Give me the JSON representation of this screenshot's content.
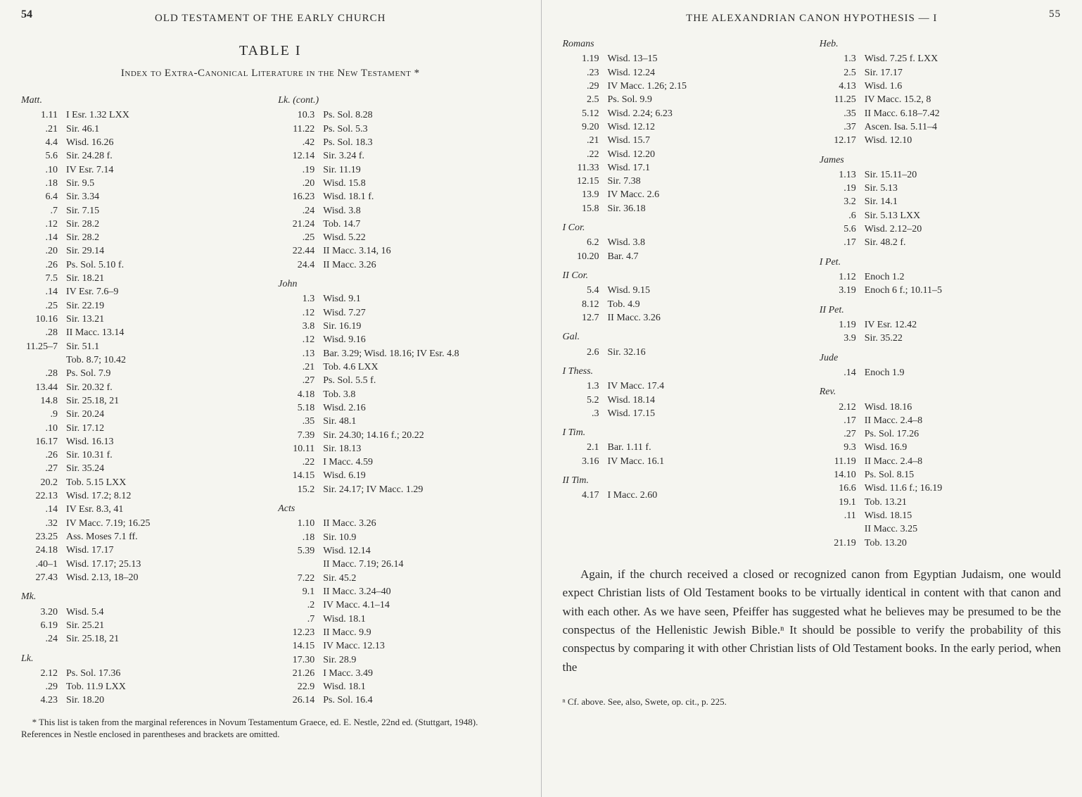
{
  "left": {
    "page_number": "54",
    "running_head": "OLD TESTAMENT OF THE EARLY CHURCH",
    "table_title": "TABLE I",
    "index_title": "Index to Extra-Canonical Literature in the New Testament *",
    "columns": [
      [
        {
          "head": "Matt."
        },
        {
          "v": "1.11",
          "r": "I Esr. 1.32 LXX"
        },
        {
          "v": ".21",
          "r": "Sir. 46.1"
        },
        {
          "v": "4.4",
          "r": "Wisd. 16.26"
        },
        {
          "v": "5.6",
          "r": "Sir. 24.28 f."
        },
        {
          "v": ".10",
          "r": "IV Esr. 7.14"
        },
        {
          "v": ".18",
          "r": "Sir. 9.5"
        },
        {
          "v": "6.4",
          "r": "Sir. 3.34"
        },
        {
          "v": ".7",
          "r": "Sir. 7.15"
        },
        {
          "v": ".12",
          "r": "Sir. 28.2"
        },
        {
          "v": ".14",
          "r": "Sir. 28.2"
        },
        {
          "v": ".20",
          "r": "Sir. 29.14"
        },
        {
          "v": ".26",
          "r": "Ps. Sol. 5.10 f."
        },
        {
          "v": "7.5",
          "r": "Sir. 18.21"
        },
        {
          "v": ".14",
          "r": "IV Esr. 7.6–9"
        },
        {
          "v": ".25",
          "r": "Sir. 22.19"
        },
        {
          "v": "10.16",
          "r": "Sir. 13.21"
        },
        {
          "v": ".28",
          "r": "II Macc. 13.14"
        },
        {
          "v": "11.25–7",
          "r": "Sir. 51.1"
        },
        {
          "v": "",
          "r": "Tob. 8.7; 10.42"
        },
        {
          "v": ".28",
          "r": "Ps. Sol. 7.9"
        },
        {
          "v": "13.44",
          "r": "Sir. 20.32 f."
        },
        {
          "v": "14.8",
          "r": "Sir. 25.18, 21"
        },
        {
          "v": ".9",
          "r": "Sir. 20.24"
        },
        {
          "v": ".10",
          "r": "Sir. 17.12"
        },
        {
          "v": "16.17",
          "r": "Wisd. 16.13"
        },
        {
          "v": ".26",
          "r": "Sir. 10.31 f."
        },
        {
          "v": ".27",
          "r": "Sir. 35.24"
        },
        {
          "v": "20.2",
          "r": "Tob. 5.15 LXX"
        },
        {
          "v": "22.13",
          "r": "Wisd. 17.2; 8.12"
        },
        {
          "v": ".14",
          "r": "IV Esr. 8.3, 41"
        },
        {
          "v": ".32",
          "r": "IV Macc. 7.19; 16.25"
        },
        {
          "v": "23.25",
          "r": "Ass. Moses 7.1 ff."
        },
        {
          "v": "24.18",
          "r": "Wisd. 17.17"
        },
        {
          "v": ".40–1",
          "r": "Wisd. 17.17; 25.13"
        },
        {
          "v": "27.43",
          "r": "Wisd. 2.13, 18–20"
        },
        {
          "head": "Mk."
        },
        {
          "v": "3.20",
          "r": "Wisd. 5.4"
        },
        {
          "v": "6.19",
          "r": "Sir. 25.21"
        },
        {
          "v": ".24",
          "r": "Sir. 25.18, 21"
        },
        {
          "head": "Lk."
        },
        {
          "v": "2.12",
          "r": "Ps. Sol. 17.36"
        },
        {
          "v": ".29",
          "r": "Tob. 11.9 LXX"
        },
        {
          "v": "4.23",
          "r": "Sir. 18.20"
        }
      ],
      [
        {
          "head": "Lk. (cont.)"
        },
        {
          "v": "10.3",
          "r": "Ps. Sol. 8.28"
        },
        {
          "v": "11.22",
          "r": "Ps. Sol. 5.3"
        },
        {
          "v": ".42",
          "r": "Ps. Sol. 18.3"
        },
        {
          "v": "12.14",
          "r": "Sir. 3.24 f."
        },
        {
          "v": ".19",
          "r": "Sir. 11.19"
        },
        {
          "v": ".20",
          "r": "Wisd. 15.8"
        },
        {
          "v": "16.23",
          "r": "Wisd. 18.1 f."
        },
        {
          "v": ".24",
          "r": "Wisd. 3.8"
        },
        {
          "v": "21.24",
          "r": "Tob. 14.7"
        },
        {
          "v": ".25",
          "r": "Wisd. 5.22"
        },
        {
          "v": "22.44",
          "r": "II Macc. 3.14, 16"
        },
        {
          "v": "24.4",
          "r": "II Macc. 3.26"
        },
        {
          "head": "John"
        },
        {
          "v": "1.3",
          "r": "Wisd. 9.1"
        },
        {
          "v": ".12",
          "r": "Wisd. 7.27"
        },
        {
          "v": "3.8",
          "r": "Sir. 16.19"
        },
        {
          "v": ".12",
          "r": "Wisd. 9.16"
        },
        {
          "v": ".13",
          "r": "Bar. 3.29; Wisd. 18.16; IV Esr. 4.8"
        },
        {
          "v": ".21",
          "r": "Tob. 4.6 LXX"
        },
        {
          "v": ".27",
          "r": "Ps. Sol. 5.5 f."
        },
        {
          "v": "4.18",
          "r": "Tob. 3.8"
        },
        {
          "v": "5.18",
          "r": "Wisd. 2.16"
        },
        {
          "v": ".35",
          "r": "Sir. 48.1"
        },
        {
          "v": "7.39",
          "r": "Sir. 24.30; 14.16 f.; 20.22"
        },
        {
          "v": "10.11",
          "r": "Sir. 18.13"
        },
        {
          "v": ".22",
          "r": "I Macc. 4.59"
        },
        {
          "v": "14.15",
          "r": "Wisd. 6.19"
        },
        {
          "v": "15.2",
          "r": "Sir. 24.17; IV Macc. 1.29"
        },
        {
          "head": "Acts"
        },
        {
          "v": "1.10",
          "r": "II Macc. 3.26"
        },
        {
          "v": ".18",
          "r": "Sir. 10.9"
        },
        {
          "v": "5.39",
          "r": "Wisd. 12.14"
        },
        {
          "v": "",
          "r": "II Macc. 7.19; 26.14"
        },
        {
          "v": "7.22",
          "r": "Sir. 45.2"
        },
        {
          "v": "9.1",
          "r": "II Macc. 3.24–40"
        },
        {
          "v": ".2",
          "r": "IV Macc. 4.1–14"
        },
        {
          "v": ".7",
          "r": "Wisd. 18.1"
        },
        {
          "v": "12.23",
          "r": "II Macc. 9.9"
        },
        {
          "v": "14.15",
          "r": "IV Macc. 12.13"
        },
        {
          "v": "17.30",
          "r": "Sir. 28.9"
        },
        {
          "v": "21.26",
          "r": "I Macc. 3.49"
        },
        {
          "v": "22.9",
          "r": "Wisd. 18.1"
        },
        {
          "v": "26.14",
          "r": "Ps. Sol. 16.4"
        }
      ]
    ],
    "footnote": "* This list is taken from the marginal references in Novum Testamentum Graece, ed. E. Nestle, 22nd ed. (Stuttgart, 1948). References in Nestle enclosed in parentheses and brackets are omitted."
  },
  "right": {
    "page_number": "55",
    "running_head": "THE ALEXANDRIAN CANON HYPOTHESIS — I",
    "columns": [
      [
        {
          "head": "Romans"
        },
        {
          "v": "1.19",
          "r": "Wisd. 13–15"
        },
        {
          "v": ".23",
          "r": "Wisd. 12.24"
        },
        {
          "v": ".29",
          "r": "IV Macc. 1.26; 2.15"
        },
        {
          "v": "2.5",
          "r": "Ps. Sol. 9.9"
        },
        {
          "v": "5.12",
          "r": "Wisd. 2.24; 6.23"
        },
        {
          "v": "9.20",
          "r": "Wisd. 12.12"
        },
        {
          "v": ".21",
          "r": "Wisd. 15.7"
        },
        {
          "v": ".22",
          "r": "Wisd. 12.20"
        },
        {
          "v": "11.33",
          "r": "Wisd. 17.1"
        },
        {
          "v": "12.15",
          "r": "Sir. 7.38"
        },
        {
          "v": "13.9",
          "r": "IV Macc. 2.6"
        },
        {
          "v": "15.8",
          "r": "Sir. 36.18"
        },
        {
          "head": "I Cor."
        },
        {
          "v": "6.2",
          "r": "Wisd. 3.8"
        },
        {
          "v": "10.20",
          "r": "Bar. 4.7"
        },
        {
          "head": "II Cor."
        },
        {
          "v": "5.4",
          "r": "Wisd. 9.15"
        },
        {
          "v": "8.12",
          "r": "Tob. 4.9"
        },
        {
          "v": "12.7",
          "r": "II Macc. 3.26"
        },
        {
          "head": "Gal."
        },
        {
          "v": "2.6",
          "r": "Sir. 32.16"
        },
        {
          "head": "I Thess."
        },
        {
          "v": "1.3",
          "r": "IV Macc. 17.4"
        },
        {
          "v": "5.2",
          "r": "Wisd. 18.14"
        },
        {
          "v": ".3",
          "r": "Wisd. 17.15"
        },
        {
          "head": "I Tim."
        },
        {
          "v": "2.1",
          "r": "Bar. 1.11 f."
        },
        {
          "v": "3.16",
          "r": "IV Macc. 16.1"
        },
        {
          "head": "II Tim."
        },
        {
          "v": "4.17",
          "r": "I Macc. 2.60"
        }
      ],
      [
        {
          "head": "Heb."
        },
        {
          "v": "1.3",
          "r": "Wisd. 7.25 f. LXX"
        },
        {
          "v": "2.5",
          "r": "Sir. 17.17"
        },
        {
          "v": "4.13",
          "r": "Wisd. 1.6"
        },
        {
          "v": "11.25",
          "r": "IV Macc. 15.2, 8"
        },
        {
          "v": ".35",
          "r": "II Macc. 6.18–7.42"
        },
        {
          "v": ".37",
          "r": "Ascen. Isa. 5.11–4"
        },
        {
          "v": "12.17",
          "r": "Wisd. 12.10"
        },
        {
          "head": "James"
        },
        {
          "v": "1.13",
          "r": "Sir. 15.11–20"
        },
        {
          "v": ".19",
          "r": "Sir. 5.13"
        },
        {
          "v": "3.2",
          "r": "Sir. 14.1"
        },
        {
          "v": ".6",
          "r": "Sir. 5.13 LXX"
        },
        {
          "v": "5.6",
          "r": "Wisd. 2.12–20"
        },
        {
          "v": ".17",
          "r": "Sir. 48.2 f."
        },
        {
          "head": "I Pet."
        },
        {
          "v": "1.12",
          "r": "Enoch 1.2"
        },
        {
          "v": "3.19",
          "r": "Enoch 6 f.; 10.11–5"
        },
        {
          "head": "II Pet."
        },
        {
          "v": "1.19",
          "r": "IV Esr. 12.42"
        },
        {
          "v": "3.9",
          "r": "Sir. 35.22"
        },
        {
          "head": "Jude"
        },
        {
          "v": ".14",
          "r": "Enoch 1.9"
        },
        {
          "head": "Rev."
        },
        {
          "v": "2.12",
          "r": "Wisd. 18.16"
        },
        {
          "v": ".17",
          "r": "II Macc. 2.4–8"
        },
        {
          "v": ".27",
          "r": "Ps. Sol. 17.26"
        },
        {
          "v": "9.3",
          "r": "Wisd. 16.9"
        },
        {
          "v": "11.19",
          "r": "II Macc. 2.4–8"
        },
        {
          "v": "14.10",
          "r": "Ps. Sol. 8.15"
        },
        {
          "v": "16.6",
          "r": "Wisd. 11.6 f.; 16.19"
        },
        {
          "v": "19.1",
          "r": "Tob. 13.21"
        },
        {
          "v": ".11",
          "r": "Wisd. 18.15"
        },
        {
          "v": "",
          "r": "II Macc. 3.25"
        },
        {
          "v": "21.19",
          "r": "Tob. 13.20"
        }
      ]
    ],
    "paragraph": "Again, if the church received a closed or recognized canon from Egyptian Judaism, one would expect Christian lists of Old Testament books to be virtually identical in content with that canon and with each other. As we have seen, Pfeiffer has suggested what he believes may be presumed to be the conspectus of the Hellenistic Jewish Bible.ⁿ It should be possible to verify the probability of this conspectus by comparing it with other Christian lists of Old Testament books. In the early period, when the",
    "footnote": "ⁿ Cf. above. See, also, Swete, op. cit., p. 225."
  }
}
